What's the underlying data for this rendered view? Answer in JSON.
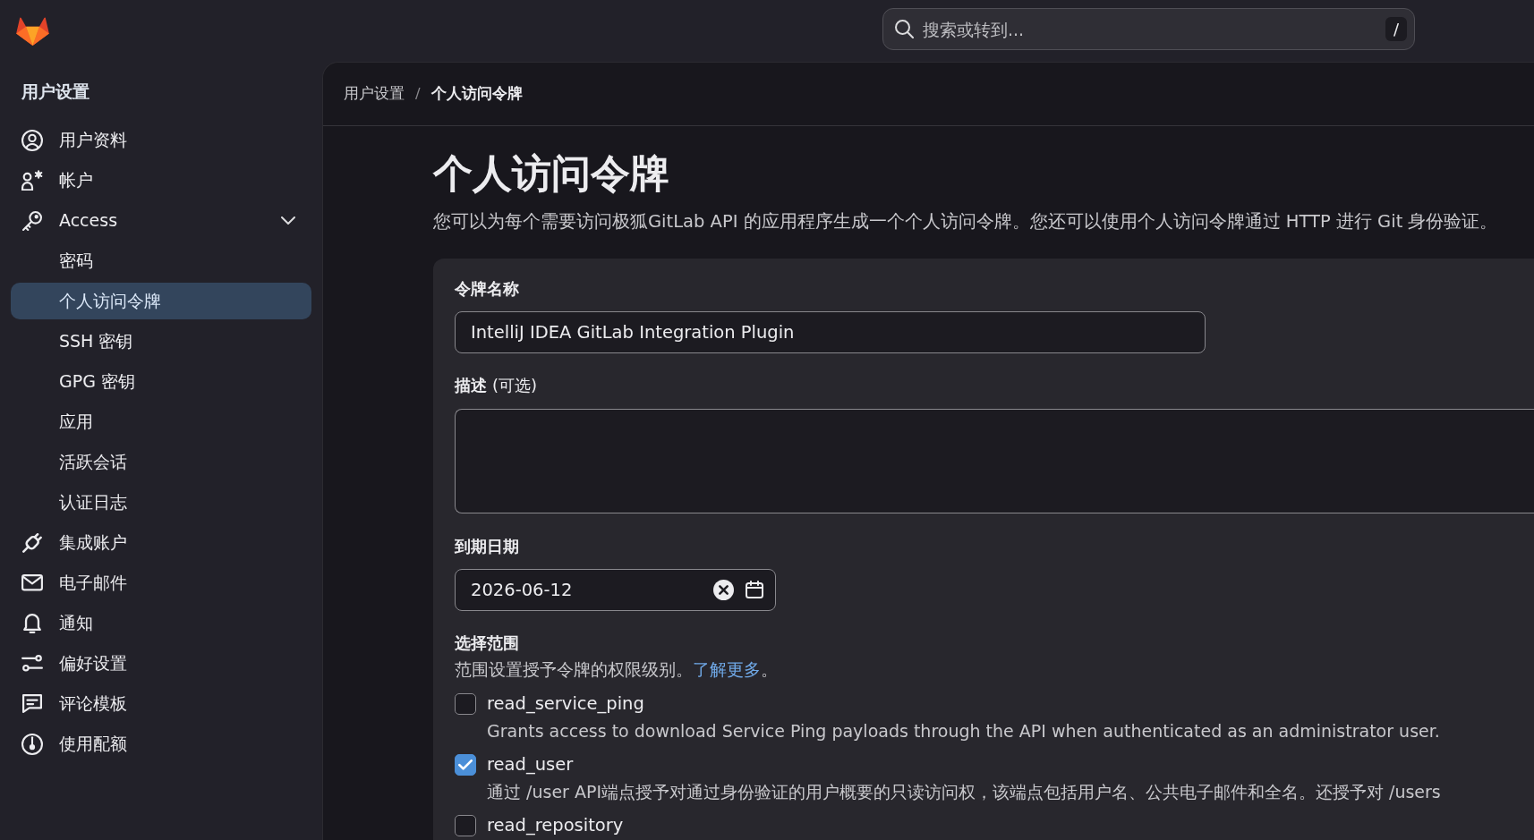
{
  "top_bar": {
    "search": {
      "placeholder": "搜索或转到...",
      "shortcut": "/"
    }
  },
  "sidebar": {
    "title": "用户设置",
    "items": [
      {
        "label": "用户资料",
        "selected": false
      },
      {
        "label": "帐户",
        "selected": false
      },
      {
        "label": "Access",
        "selected": false,
        "expanded": true,
        "children": [
          {
            "label": "密码",
            "selected": false
          },
          {
            "label": "个人访问令牌",
            "selected": true
          },
          {
            "label": "SSH 密钥",
            "selected": false
          },
          {
            "label": "GPG 密钥",
            "selected": false
          },
          {
            "label": "应用",
            "selected": false
          },
          {
            "label": "活跃会话",
            "selected": false
          },
          {
            "label": "认证日志",
            "selected": false
          }
        ]
      },
      {
        "label": "集成账户",
        "selected": false
      },
      {
        "label": "电子邮件",
        "selected": false
      },
      {
        "label": "通知",
        "selected": false
      },
      {
        "label": "偏好设置",
        "selected": false
      },
      {
        "label": "评论模板",
        "selected": false
      },
      {
        "label": "使用配额",
        "selected": false
      }
    ]
  },
  "breadcrumb": {
    "items": [
      "用户设置",
      "个人访问令牌"
    ],
    "separator": "/"
  },
  "page": {
    "title": "个人访问令牌",
    "description": "您可以为每个需要访问极狐GitLab API 的应用程序生成一个个人访问令牌。您还可以使用个人访问令牌通过 HTTP 进行 Git 身份验证。"
  },
  "form": {
    "fields": [
      {
        "kind": "text",
        "label": "令牌名称",
        "value": "IntelliJ IDEA GitLab Integration Plugin"
      },
      {
        "kind": "textarea",
        "label": "描述",
        "optional_note": "(可选)"
      },
      {
        "kind": "date",
        "label": "到期日期",
        "value": "2026-06-12"
      }
    ],
    "scopes": {
      "title": "选择范围",
      "help": "范围设置授予令牌的权限级别。",
      "link": "了解更多",
      "help_end": "。",
      "items": [
        {
          "name": "read_service_ping",
          "checked": false,
          "description": "Grants access to download Service Ping payloads through the API when authenticated as an administrator user."
        },
        {
          "name": "read_user",
          "checked": true,
          "description": "通过 /user API端点授予对通过身份验证的用户概要的只读访问权，该端点包括用户名、公共电子邮件和全名。还授予对 /users"
        },
        {
          "name": "read_repository",
          "checked": false
        }
      ]
    }
  }
}
